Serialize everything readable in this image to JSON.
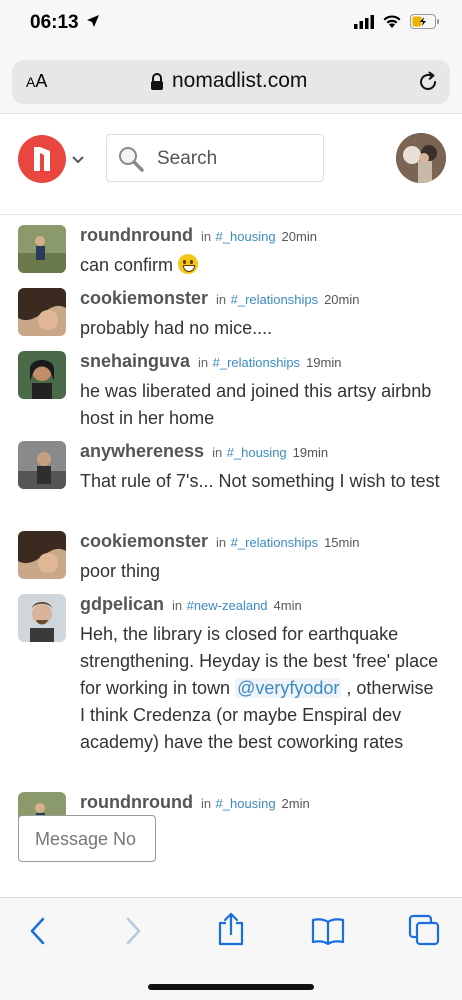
{
  "status": {
    "time": "06:13"
  },
  "browser": {
    "aa": "AA",
    "url": "nomadlist.com"
  },
  "header": {
    "search_label": "Search"
  },
  "messages": [
    {
      "user": "roundnround",
      "in": "in",
      "channel": "#_housing",
      "time": "20min",
      "text": "can confirm"
    },
    {
      "user": "cookiemonster",
      "in": "in",
      "channel": "#_relationships",
      "time": "20min",
      "text": "probably had no mice...."
    },
    {
      "user": "snehainguva",
      "in": "in",
      "channel": "#_relationships",
      "time": "19min",
      "text": "he was liberated and joined this artsy airbnb host in her home"
    },
    {
      "user": "anywhereness",
      "in": "in",
      "channel": "#_housing",
      "time": "19min",
      "text": "That rule of 7's... Not something I wish to test"
    },
    {
      "user": "cookiemonster",
      "in": "in",
      "channel": "#_relationships",
      "time": "15min",
      "text": "poor thing"
    },
    {
      "user": "gdpelican",
      "in": "in",
      "channel": "#new-zealand",
      "time": "4min",
      "text": "Heh, the library is closed for earthquake strengthening. Heyday is the best 'free' place for working in town",
      "mention": "@veryfyodor",
      "text_after": ", otherwise I think Credenza (or maybe Enspiral dev academy) have the best coworking rates"
    },
    {
      "user": "roundnround",
      "in": "in",
      "channel": "#_housing",
      "time": "2min",
      "text": ""
    }
  ],
  "composer": {
    "placeholder": "Message No"
  },
  "colors": {
    "brand": "#e8463f",
    "link": "#3b8bc4",
    "ios_blue": "#1a6fe0"
  },
  "icons": {
    "back": "chevron-left-icon",
    "forward": "chevron-right-icon",
    "share": "share-icon",
    "bookmarks": "book-icon",
    "tabs": "tabs-icon"
  }
}
